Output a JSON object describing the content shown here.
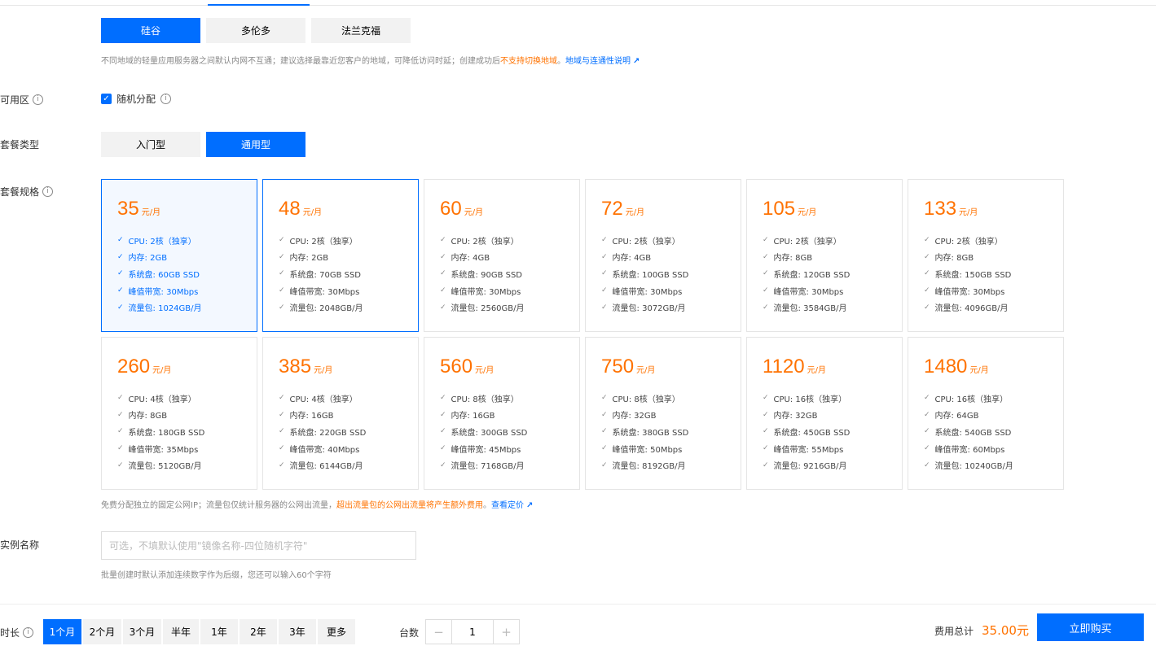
{
  "regions": [
    "硅谷",
    "多伦多",
    "法兰克福"
  ],
  "region_note": {
    "text": "不同地域的轻量应用服务器之间默认内网不互通；建议选择最靠近您客户的地域，可降低访问时延；创建成功后",
    "warn": "不支持切换地域",
    "sep": "。",
    "link": "地域与连通性说明"
  },
  "zone": {
    "label": "可用区",
    "option": "随机分配"
  },
  "plan_type": {
    "label": "套餐类型",
    "options": [
      "入门型",
      "通用型"
    ]
  },
  "plan_spec_label": "套餐规格",
  "price_unit": "元/月",
  "plans": [
    {
      "price": "35",
      "cpu": "CPU: 2核（独享）",
      "mem": "内存: 2GB",
      "disk": "系统盘: 60GB SSD",
      "bw": "峰值带宽: 30Mbps",
      "traffic": "流量包: 1024GB/月"
    },
    {
      "price": "48",
      "cpu": "CPU: 2核（独享）",
      "mem": "内存: 2GB",
      "disk": "系统盘: 70GB SSD",
      "bw": "峰值带宽: 30Mbps",
      "traffic": "流量包: 2048GB/月"
    },
    {
      "price": "60",
      "cpu": "CPU: 2核（独享）",
      "mem": "内存: 4GB",
      "disk": "系统盘: 90GB SSD",
      "bw": "峰值带宽: 30Mbps",
      "traffic": "流量包: 2560GB/月"
    },
    {
      "price": "72",
      "cpu": "CPU: 2核（独享）",
      "mem": "内存: 4GB",
      "disk": "系统盘: 100GB SSD",
      "bw": "峰值带宽: 30Mbps",
      "traffic": "流量包: 3072GB/月"
    },
    {
      "price": "105",
      "cpu": "CPU: 2核（独享）",
      "mem": "内存: 8GB",
      "disk": "系统盘: 120GB SSD",
      "bw": "峰值带宽: 30Mbps",
      "traffic": "流量包: 3584GB/月"
    },
    {
      "price": "133",
      "cpu": "CPU: 2核（独享）",
      "mem": "内存: 8GB",
      "disk": "系统盘: 150GB SSD",
      "bw": "峰值带宽: 30Mbps",
      "traffic": "流量包: 4096GB/月"
    },
    {
      "price": "260",
      "cpu": "CPU: 4核（独享）",
      "mem": "内存: 8GB",
      "disk": "系统盘: 180GB SSD",
      "bw": "峰值带宽: 35Mbps",
      "traffic": "流量包: 5120GB/月"
    },
    {
      "price": "385",
      "cpu": "CPU: 4核（独享）",
      "mem": "内存: 16GB",
      "disk": "系统盘: 220GB SSD",
      "bw": "峰值带宽: 40Mbps",
      "traffic": "流量包: 6144GB/月"
    },
    {
      "price": "560",
      "cpu": "CPU: 8核（独享）",
      "mem": "内存: 16GB",
      "disk": "系统盘: 300GB SSD",
      "bw": "峰值带宽: 45Mbps",
      "traffic": "流量包: 7168GB/月"
    },
    {
      "price": "750",
      "cpu": "CPU: 8核（独享）",
      "mem": "内存: 32GB",
      "disk": "系统盘: 380GB SSD",
      "bw": "峰值带宽: 50Mbps",
      "traffic": "流量包: 8192GB/月"
    },
    {
      "price": "1120",
      "cpu": "CPU: 16核（独享）",
      "mem": "内存: 32GB",
      "disk": "系统盘: 450GB SSD",
      "bw": "峰值带宽: 55Mbps",
      "traffic": "流量包: 9216GB/月"
    },
    {
      "price": "1480",
      "cpu": "CPU: 16核（独享）",
      "mem": "内存: 64GB",
      "disk": "系统盘: 540GB SSD",
      "bw": "峰值带宽: 60Mbps",
      "traffic": "流量包: 10240GB/月"
    }
  ],
  "ip_note": {
    "text": "免费分配独立的固定公网IP；流量包仅统计服务器的公网出流量，",
    "warn": "超出流量包的公网出流量将产生额外费用",
    "sep": "。",
    "link": "查看定价"
  },
  "instance": {
    "label": "实例名称",
    "placeholder": "可选，不填默认使用\"镜像名称-四位随机字符\"",
    "note": "批量创建时默认添加连续数字作为后缀，您还可以输入60个字符"
  },
  "duration": {
    "label": "时长",
    "options": [
      "1个月",
      "2个月",
      "3个月",
      "半年",
      "1年",
      "2年",
      "3年",
      "更多"
    ]
  },
  "quantity": {
    "label": "台数",
    "value": "1",
    "minus": "−",
    "plus": "+"
  },
  "total": {
    "label": "费用总计",
    "value": "35.00元"
  },
  "buy_label": "立即购买",
  "colors": {
    "accent": "#006eff",
    "price": "#ff7200"
  }
}
